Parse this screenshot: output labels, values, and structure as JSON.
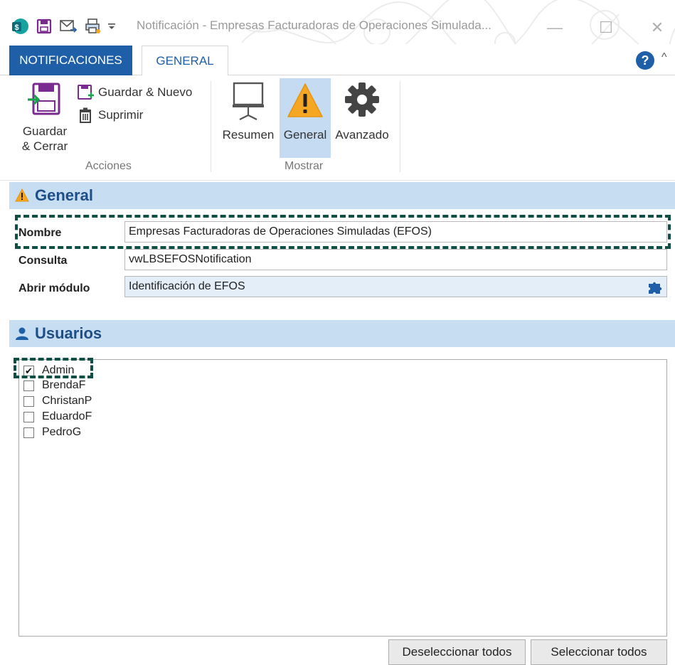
{
  "window": {
    "title": "Notificación - Empresas Facturadoras de Operaciones Simulada...",
    "minimize_glyph": "—",
    "maximize_glyph": "☐",
    "close_glyph": "✕"
  },
  "ribbon_tabs": [
    {
      "label": "NOTIFICACIONES",
      "active": false
    },
    {
      "label": "GENERAL",
      "active": true
    }
  ],
  "help_glyph": "?",
  "collapse_glyph": "^",
  "ribbon": {
    "acciones": {
      "label": "Acciones",
      "guardar_cerrar_line1": "Guardar",
      "guardar_cerrar_line2": "& Cerrar",
      "guardar_nuevo": "Guardar & Nuevo",
      "suprimir": "Suprimir"
    },
    "mostrar": {
      "label": "Mostrar",
      "resumen": "Resumen",
      "general": "General",
      "avanzado": "Avanzado"
    }
  },
  "general_section": {
    "title": "General",
    "nombre_label": "Nombre",
    "nombre_value": "Empresas Facturadoras de Operaciones Simuladas (EFOS)",
    "consulta_label": "Consulta",
    "consulta_value": "vwLBSEFOSNotification",
    "abrir_label": "Abrir módulo",
    "abrir_value": "Identificación de EFOS"
  },
  "users_section": {
    "title": "Usuarios",
    "users": [
      {
        "name": "Admin",
        "checked": true
      },
      {
        "name": "BrendaF",
        "checked": false
      },
      {
        "name": "ChristanP",
        "checked": false
      },
      {
        "name": "EduardoF",
        "checked": false
      },
      {
        "name": "PedroG",
        "checked": false
      }
    ],
    "check_glyph": "✔"
  },
  "buttons": {
    "deselect_all": "Deseleccionar todos",
    "select_all": "Seleccionar todos"
  },
  "colors": {
    "accent": "#1f5fa8",
    "section_header": "#c7ddf1",
    "highlight_dash": "#0e4f45",
    "warning": "#f5a623"
  }
}
